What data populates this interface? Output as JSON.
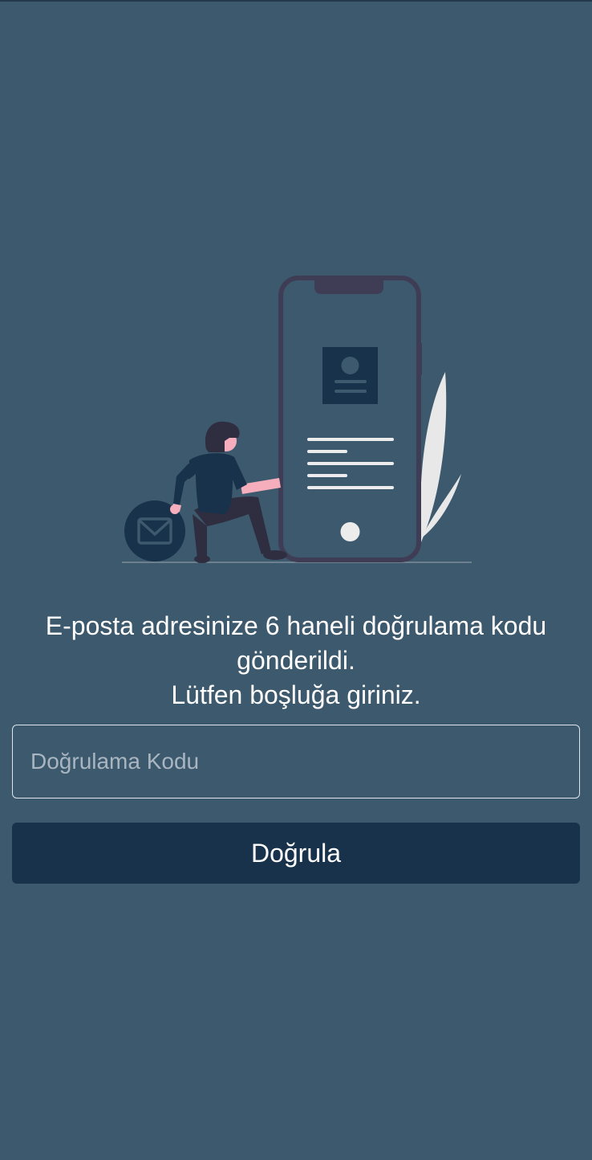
{
  "message": {
    "line1": "E-posta adresinize 6 haneli doğrulama kodu gönderildi.",
    "line2": "Lütfen boşluğa giriniz."
  },
  "code_field": {
    "placeholder": "Doğrulama Kodu",
    "value": ""
  },
  "verify_button": {
    "label": "Doğrula"
  },
  "colors": {
    "background": "#3d596d",
    "button": "#17324a",
    "text": "#ffffff",
    "placeholder": "#a9b6c1"
  }
}
